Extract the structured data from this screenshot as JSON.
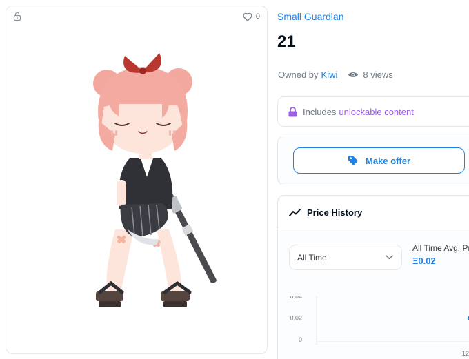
{
  "asset": {
    "favorite_count": "0",
    "icons": {
      "lock": "lock-icon",
      "favorite": "heart-icon"
    }
  },
  "item": {
    "collection": "Small Guardian",
    "name": "21",
    "owned_by_label": "Owned by",
    "owner": "Kiwi",
    "views": "8 views"
  },
  "unlockable": {
    "prefix": "Includes",
    "link": "unlockable content"
  },
  "offer": {
    "button_label": "Make offer"
  },
  "price_history": {
    "title": "Price History",
    "period_selected": "All Time",
    "avg_label": "All Time Avg. Pr",
    "avg_value": "Ξ0.02"
  },
  "chart_data": {
    "type": "line",
    "title": "",
    "xlabel": "",
    "ylabel": "",
    "ylim": [
      0,
      0.04
    ],
    "y_ticks": [
      "0.04",
      "0.02",
      "0"
    ],
    "x_ticks": [
      "12"
    ],
    "series": [
      {
        "points": [
          {
            "x": "12",
            "y": 0.02
          }
        ]
      }
    ]
  },
  "colors": {
    "accent": "#2081e2",
    "unlockable": "#9b5de5",
    "text": "#353840",
    "muted": "#707a83",
    "border": "#e5e8eb"
  }
}
